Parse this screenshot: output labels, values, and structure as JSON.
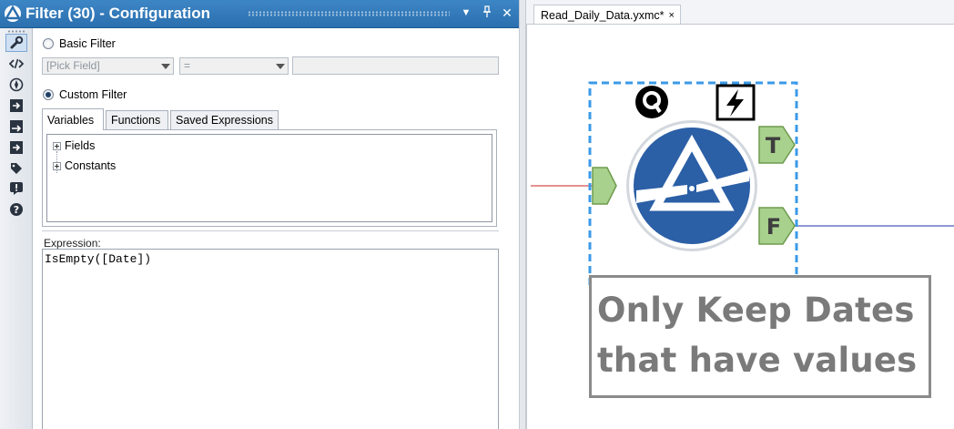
{
  "config_panel": {
    "title": "Filter (30) - Configuration",
    "title_buttons": [
      "chevron-down-icon",
      "pin-icon",
      "close-icon"
    ],
    "toolbar_icons": [
      "wrench-icon",
      "code-icon",
      "compass-icon",
      "input-arrow-icon",
      "output-arrow-icon",
      "annotation-arrow-icon",
      "tag-icon",
      "alert-icon",
      "help-icon"
    ],
    "basic_filter": {
      "label": "Basic Filter",
      "selected": false,
      "field_placeholder": "[Pick Field]",
      "operator_value": "=",
      "value_field": ""
    },
    "custom_filter": {
      "label": "Custom Filter",
      "selected": true
    },
    "tabs": [
      {
        "label": "Variables",
        "active": true
      },
      {
        "label": "Functions",
        "active": false
      },
      {
        "label": "Saved Expressions",
        "active": false
      }
    ],
    "tree": [
      {
        "label": "Fields"
      },
      {
        "label": "Constants"
      }
    ],
    "expression": {
      "label": "Expression:",
      "value": "IsEmpty([Date])"
    }
  },
  "canvas": {
    "document_tab": {
      "label": "Read_Daily_Data.yxmc*",
      "close": "×"
    },
    "tool": {
      "name": "filter-tool",
      "badge_q": "Q",
      "true_anchor": "T",
      "false_anchor": "F"
    },
    "annotation": {
      "lines": [
        "Only Keep Dates",
        "that have values"
      ]
    }
  },
  "colors": {
    "title_bar": "#2f77b8",
    "filter_blue": "#2b5fa6",
    "anchor_green": "#a9d18e",
    "selection_dash": "#3a9ae8",
    "wire_in": "#cc2222",
    "wire_out": "#2233aa"
  }
}
